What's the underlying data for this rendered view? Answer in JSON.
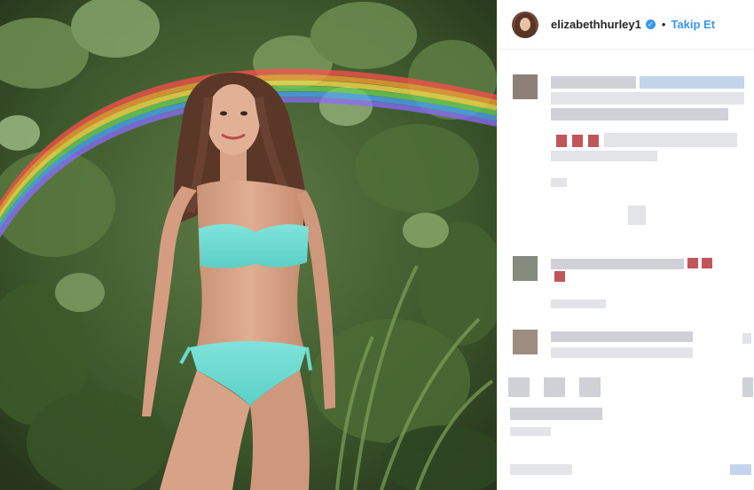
{
  "post": {
    "username": "elizabethhurley1",
    "verified": true,
    "follow_label": "Takip Et",
    "separator": "•"
  },
  "icons": {
    "verified": "verified-check-icon"
  },
  "colors": {
    "link_blue": "#3897f0",
    "text_dark": "#262626",
    "divider": "#efefef"
  }
}
